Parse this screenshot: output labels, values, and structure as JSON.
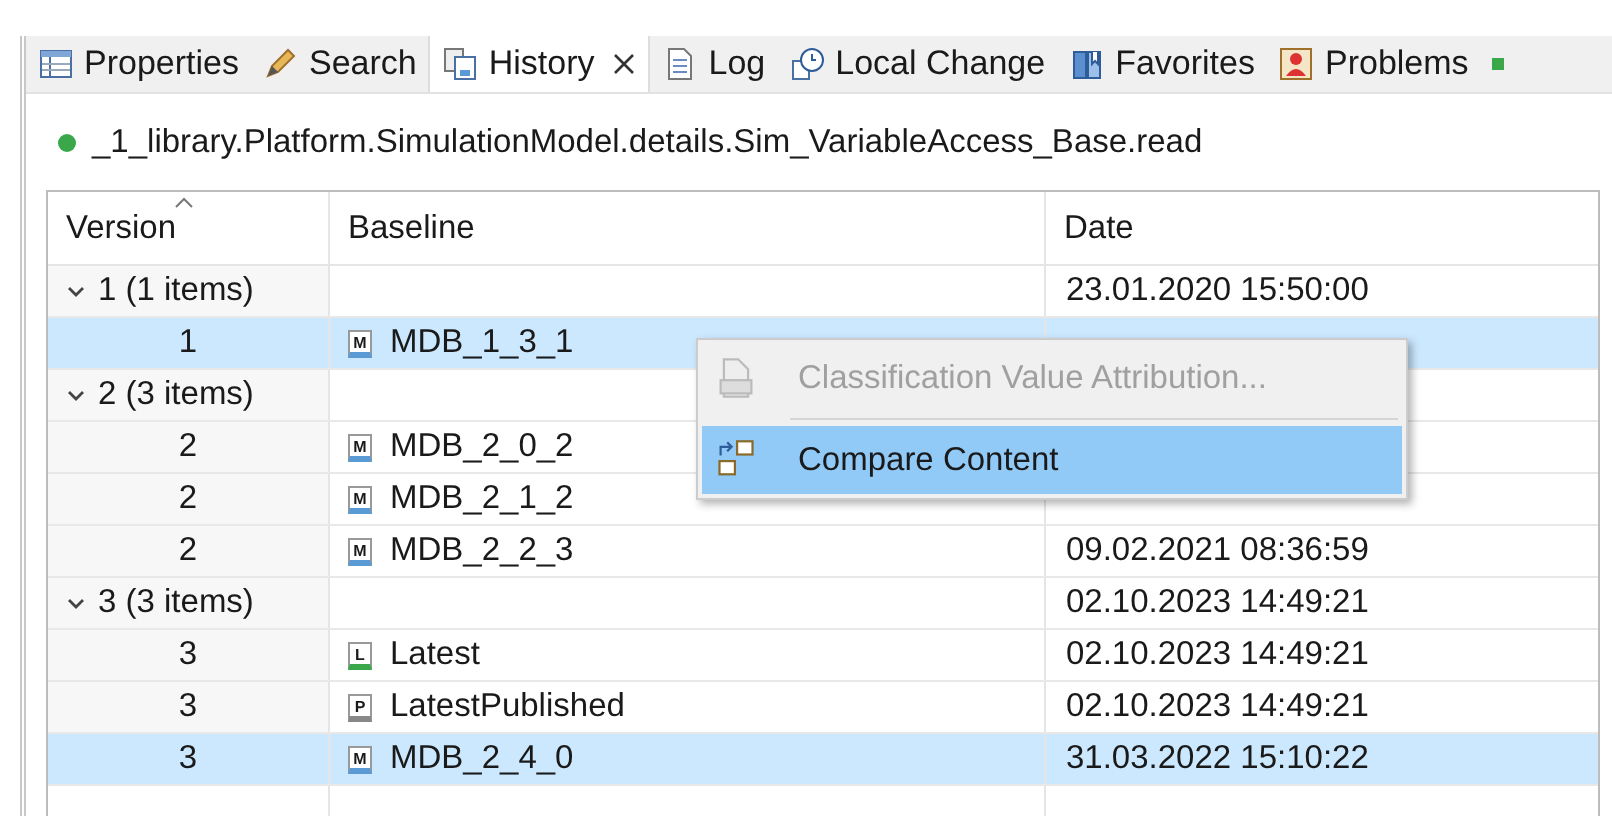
{
  "tabs": [
    {
      "label": "Properties",
      "selected": false,
      "closable": false
    },
    {
      "label": "Search",
      "selected": false,
      "closable": false
    },
    {
      "label": "History",
      "selected": true,
      "closable": true
    },
    {
      "label": "Log",
      "selected": false,
      "closable": false
    },
    {
      "label": "Local Change",
      "selected": false,
      "closable": false
    },
    {
      "label": "Favorites",
      "selected": false,
      "closable": false
    },
    {
      "label": "Problems",
      "selected": false,
      "closable": false
    }
  ],
  "path": {
    "text": "_1_library.Platform.SimulationModel.details.Sim_VariableAccess_Base.read"
  },
  "table": {
    "columns": [
      {
        "label": "Version",
        "sorted": true
      },
      {
        "label": "Baseline",
        "sorted": false
      },
      {
        "label": "Date",
        "sorted": false
      }
    ],
    "groups": [
      {
        "label": "1 (1 items)",
        "expanded": true,
        "date": "23.01.2020 15:50:00",
        "children": [
          {
            "version": "1",
            "badge": "M",
            "kind": "model",
            "baseline": "MDB_1_3_1",
            "selected": true
          }
        ]
      },
      {
        "label": "2 (3 items)",
        "expanded": true,
        "children": [
          {
            "version": "2",
            "badge": "M",
            "kind": "model",
            "baseline": "MDB_2_0_2",
            "selected": false
          },
          {
            "version": "2",
            "badge": "M",
            "kind": "model",
            "baseline": "MDB_2_1_2",
            "selected": false
          },
          {
            "version": "2",
            "badge": "M",
            "kind": "model",
            "baseline": "MDB_2_2_3",
            "date": "09.02.2021 08:36:59",
            "selected": false
          }
        ]
      },
      {
        "label": "3 (3 items)",
        "expanded": true,
        "date": "02.10.2023 14:49:21",
        "children": [
          {
            "version": "3",
            "badge": "L",
            "kind": "latest",
            "baseline": "Latest",
            "date": "02.10.2023 14:49:21",
            "selected": false
          },
          {
            "version": "3",
            "badge": "P",
            "kind": "published",
            "baseline": "LatestPublished",
            "date": "02.10.2023 14:49:21",
            "selected": false
          },
          {
            "version": "3",
            "badge": "M",
            "kind": "model",
            "baseline": "MDB_2_4_0",
            "date": "31.03.2022 15:10:22",
            "selected": true
          }
        ]
      }
    ]
  },
  "context_menu": {
    "items": [
      {
        "label": "Classification Value Attribution...",
        "disabled": true,
        "selected": false
      },
      {
        "label": "Compare Content",
        "disabled": false,
        "selected": true
      }
    ]
  }
}
